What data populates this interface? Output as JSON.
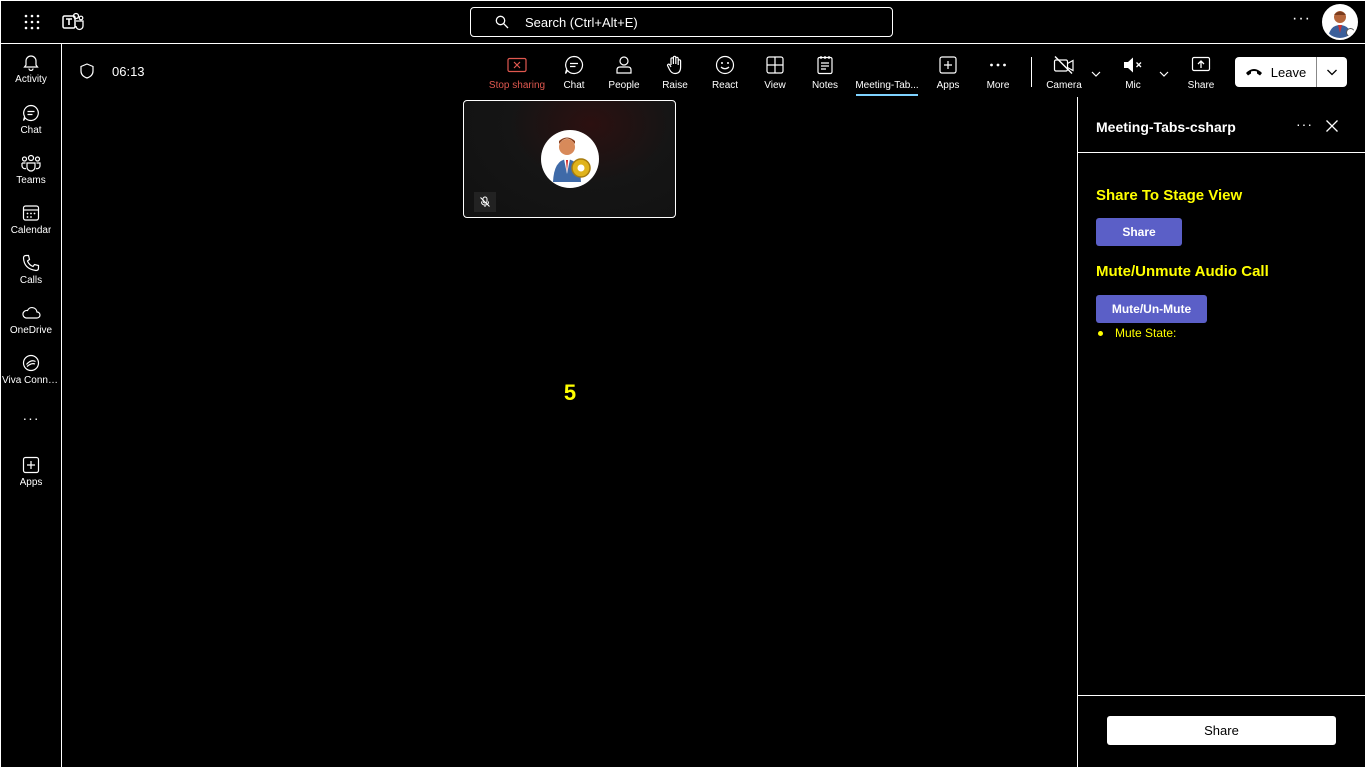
{
  "titlebar": {
    "search_placeholder": "Search (Ctrl+Alt+E)",
    "more": "···"
  },
  "rail": {
    "items": [
      {
        "label": "Activity",
        "icon": "bell-icon"
      },
      {
        "label": "Chat",
        "icon": "chat-icon"
      },
      {
        "label": "Teams",
        "icon": "teams-icon"
      },
      {
        "label": "Calendar",
        "icon": "calendar-icon"
      },
      {
        "label": "Calls",
        "icon": "phone-icon"
      },
      {
        "label": "OneDrive",
        "icon": "cloud-icon"
      },
      {
        "label": "Viva Conne...",
        "icon": "viva-connections-icon"
      },
      {
        "label": "Apps",
        "icon": "add-apps-icon"
      }
    ],
    "more": "···"
  },
  "meeting": {
    "timer": "06:13",
    "toolbar": [
      {
        "label": "Stop sharing",
        "icon": "stop-sharing-icon"
      },
      {
        "label": "Chat",
        "icon": "chat-icon"
      },
      {
        "label": "People",
        "icon": "people-icon"
      },
      {
        "label": "Raise",
        "icon": "raise-hand-icon"
      },
      {
        "label": "React",
        "icon": "react-icon"
      },
      {
        "label": "View",
        "icon": "view-icon"
      },
      {
        "label": "Notes",
        "icon": "notes-icon"
      },
      {
        "label": "Meeting-Tab...",
        "icon": "meeting-tab-icon"
      },
      {
        "label": "Apps",
        "icon": "add-apps-icon"
      },
      {
        "label": "More",
        "icon": "more-icon"
      },
      {
        "label": "Camera",
        "icon": "camera-off-icon"
      },
      {
        "label": "Mic",
        "icon": "mic-off-icon"
      },
      {
        "label": "Share",
        "icon": "share-icon"
      }
    ],
    "leave_label": "Leave",
    "stage_number": "5",
    "colors": {
      "stop_sharing": "#e0584f",
      "active_tab_underline": "#7fd3ff"
    }
  },
  "panel": {
    "title": "Meeting-Tabs-csharp",
    "more": "···",
    "section1_title": "Share To Stage View",
    "share_button": "Share",
    "section2_title": "Mute/Unmute Audio Call",
    "mute_button": "Mute/Un-Mute",
    "mute_state_label": "Mute State:",
    "footer_share": "Share",
    "colors": {
      "heading": "#ffff00",
      "button": "#5b5fc7"
    }
  }
}
